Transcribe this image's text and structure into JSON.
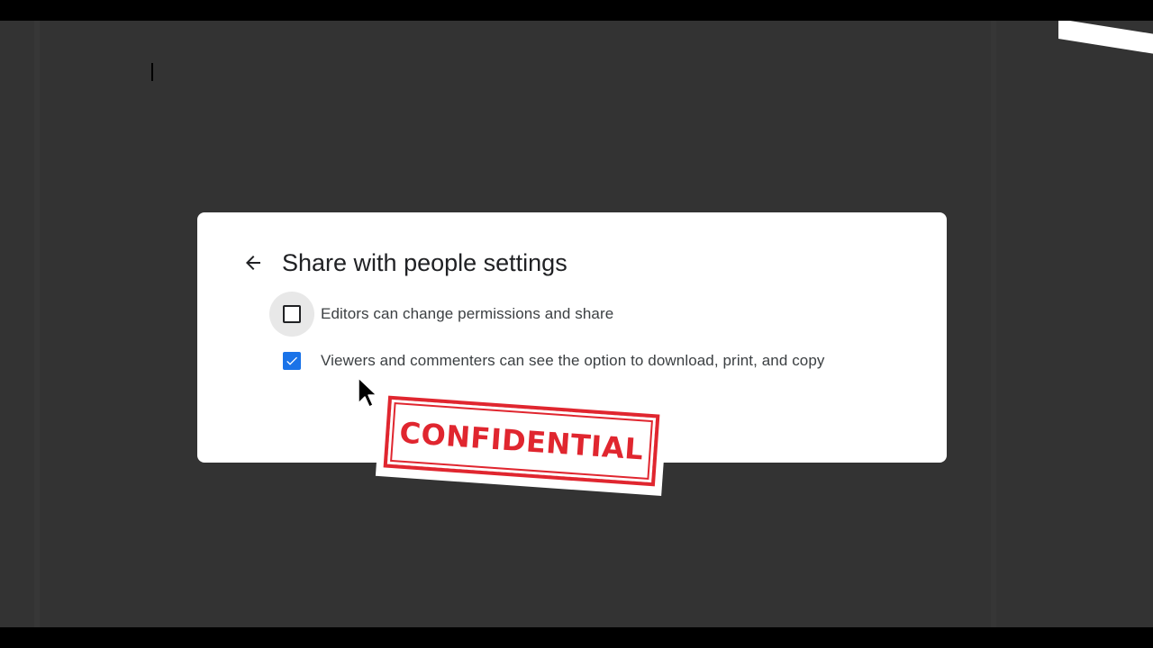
{
  "dialog": {
    "title": "Share with people settings",
    "options": [
      {
        "label": "Editors can change permissions and share",
        "checked": false
      },
      {
        "label": "Viewers and commenters can see the option to download, print, and copy",
        "checked": true
      }
    ]
  },
  "stamp": {
    "text": "CONFIDENTIAL"
  },
  "icons": {
    "back": "arrow-back-icon",
    "checkmark": "checkmark-icon",
    "cursor": "mouse-pointer-icon"
  },
  "colors": {
    "backdrop": "#333333",
    "dialog_bg": "#ffffff",
    "checkbox_checked": "#1a73e8",
    "stamp": "#e0262f"
  }
}
